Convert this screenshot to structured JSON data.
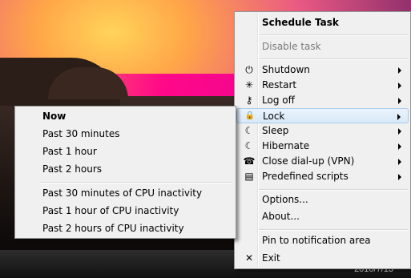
{
  "main_menu": {
    "title": "Schedule Task",
    "disable": "Disable task",
    "items": [
      {
        "label": "Shutdown",
        "icon": "power-icon",
        "glyph": "⏻"
      },
      {
        "label": "Restart",
        "icon": "restart-icon",
        "glyph": "✳"
      },
      {
        "label": "Log off",
        "icon": "key-icon",
        "glyph": "⚷"
      },
      {
        "label": "Lock",
        "icon": "lock-icon",
        "glyph": "🔒"
      },
      {
        "label": "Sleep",
        "icon": "moon-icon",
        "glyph": "☾"
      },
      {
        "label": "Hibernate",
        "icon": "moon-icon",
        "glyph": "☾"
      },
      {
        "label": "Close dial-up (VPN)",
        "icon": "phone-icon",
        "glyph": "☎"
      },
      {
        "label": "Predefined scripts",
        "icon": "script-icon",
        "glyph": "▤"
      }
    ],
    "options": "Options...",
    "about": "About...",
    "pin": "Pin to notification area",
    "exit": "Exit",
    "exit_glyph": "✕"
  },
  "sub_menu": {
    "now": "Now",
    "items": [
      "Past 30 minutes",
      "Past 1 hour",
      "Past 2 hours"
    ],
    "cpu_items": [
      "Past 30 minutes of CPU inactivity",
      "Past 1 hour of CPU inactivity",
      "Past 2 hours of CPU inactivity"
    ]
  },
  "taskbar": {
    "date": "2010/7/13"
  }
}
